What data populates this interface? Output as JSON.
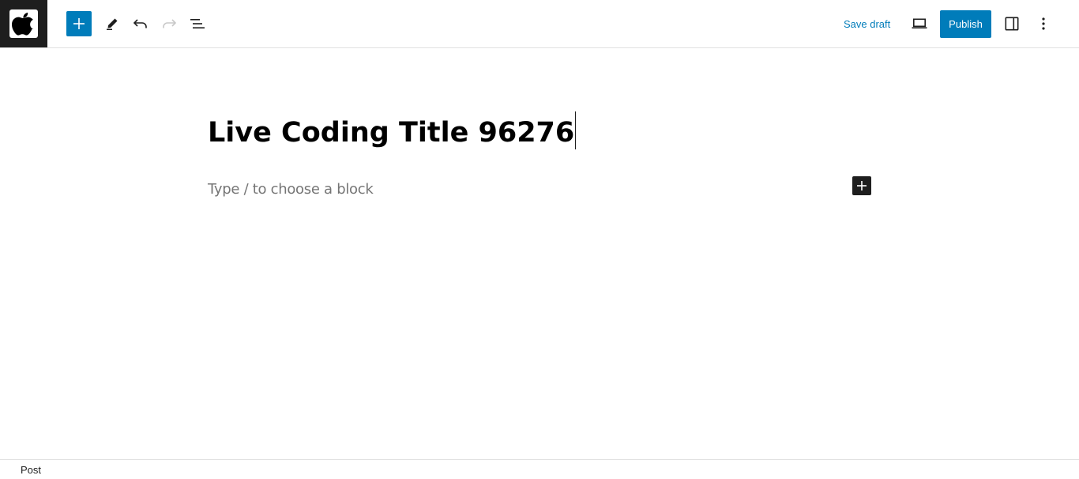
{
  "header": {
    "logo_icon": "apple-logo-icon",
    "inserter_icon": "plus-icon",
    "tools_icon": "pencil-icon",
    "undo_icon": "undo-icon",
    "redo_icon": "redo-icon",
    "outline_icon": "list-view-icon",
    "save_draft_label": "Save draft",
    "preview_icon": "laptop-icon",
    "publish_label": "Publish",
    "settings_icon": "sidebar-icon",
    "options_icon": "more-vertical-icon",
    "accent_color": "#007cba"
  },
  "editor": {
    "post_title": "Live Coding Title 96276",
    "block_placeholder": "Type / to choose a block",
    "block_inserter_icon": "plus-icon"
  },
  "footer": {
    "breadcrumb": "Post"
  }
}
